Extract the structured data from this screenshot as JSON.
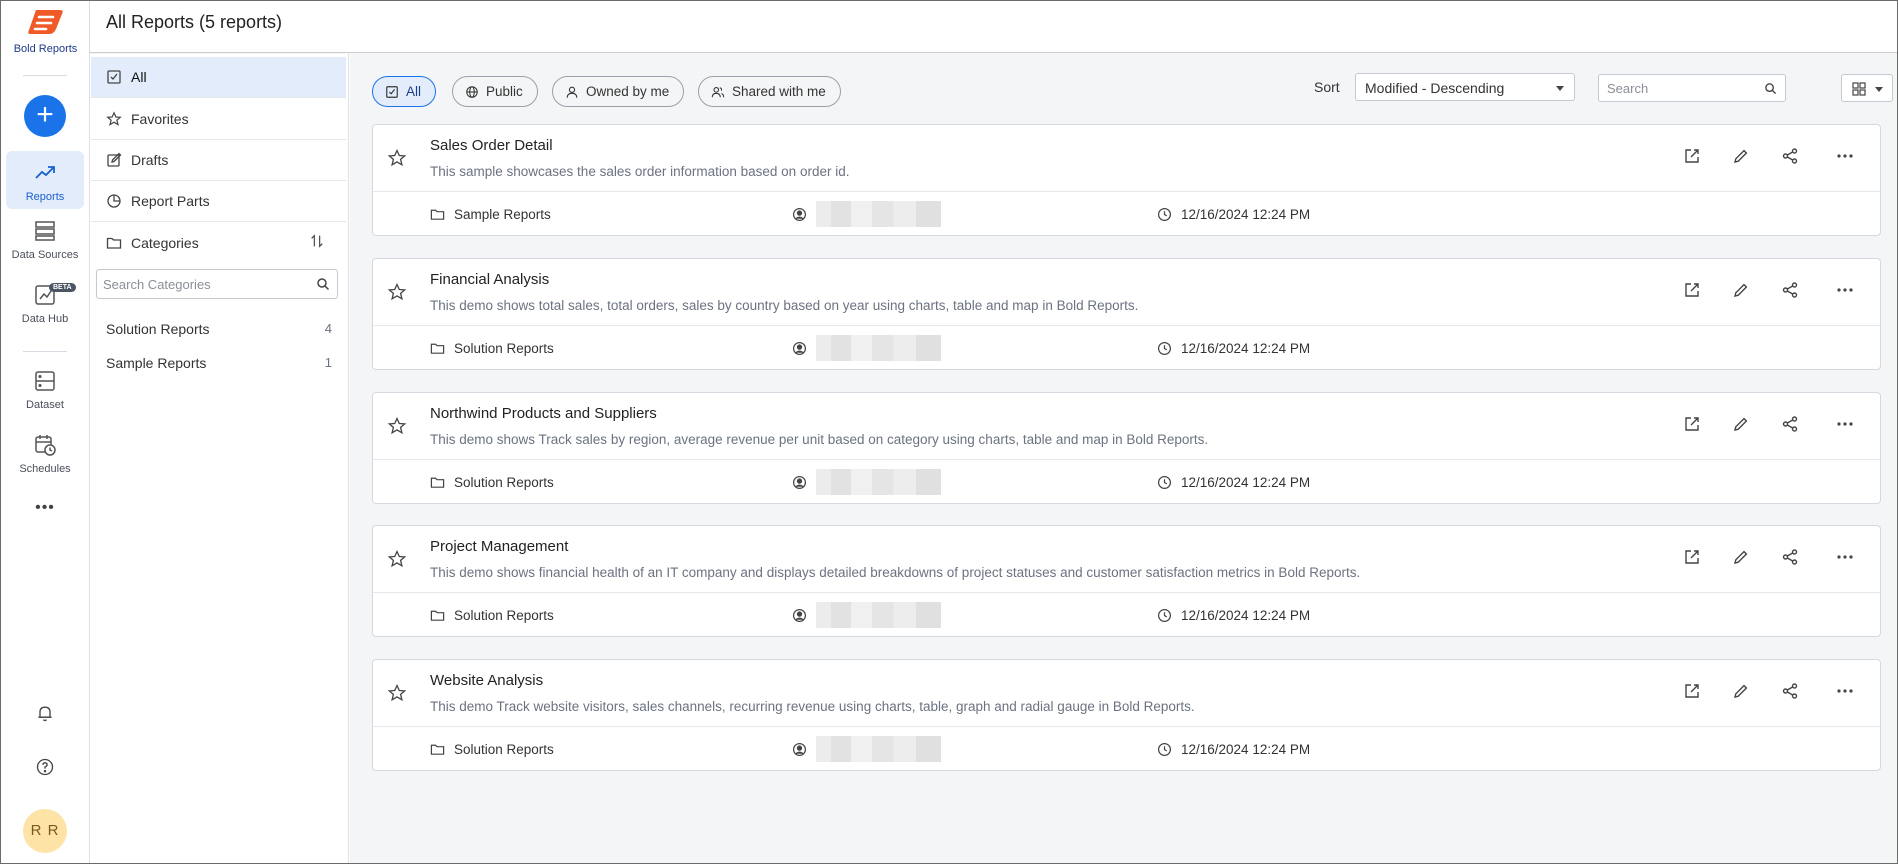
{
  "brand": {
    "logo_text": "Bold Reports",
    "accent": "#1a73e8",
    "logo_color": "#f05a28"
  },
  "rail": {
    "items": [
      {
        "label": "Reports",
        "icon": "trending-up-icon"
      },
      {
        "label": "Data Sources",
        "icon": "database-icon"
      },
      {
        "label": "Data Hub",
        "icon": "chart-box-icon",
        "badge": "BETA"
      },
      {
        "label": "Dataset",
        "icon": "dataset-icon"
      },
      {
        "label": "Schedules",
        "icon": "calendar-clock-icon"
      }
    ],
    "more_label": "•••",
    "avatar_initials": "R R"
  },
  "header": {
    "title": "All Reports (5 reports)"
  },
  "filter": {
    "items": [
      {
        "label": "All",
        "icon": "checkbox-icon"
      },
      {
        "label": "Favorites",
        "icon": "star-icon"
      },
      {
        "label": "Drafts",
        "icon": "edit-icon"
      },
      {
        "label": "Report Parts",
        "icon": "pie-icon"
      },
      {
        "label": "Categories",
        "icon": "folder-icon"
      }
    ],
    "category_search_placeholder": "Search Categories",
    "categories": [
      {
        "name": "Solution Reports",
        "count": "4"
      },
      {
        "name": "Sample Reports",
        "count": "1"
      }
    ]
  },
  "toolbar": {
    "pills": [
      {
        "label": "All",
        "icon": "checkbox-icon"
      },
      {
        "label": "Public",
        "icon": "globe-icon"
      },
      {
        "label": "Owned by me",
        "icon": "user-icon"
      },
      {
        "label": "Shared with me",
        "icon": "users-icon"
      }
    ],
    "sort_label": "Sort",
    "sort_value": "Modified - Descending",
    "search_placeholder": "Search"
  },
  "reports": [
    {
      "title": "Sales Order Detail",
      "description": "This sample showcases the sales order information based on order id.",
      "category": "Sample Reports",
      "modified": "12/16/2024 12:24 PM"
    },
    {
      "title": "Financial Analysis",
      "description": "This demo shows total sales, total orders, sales by country based on year using charts, table and map in Bold Reports.",
      "category": "Solution Reports",
      "modified": "12/16/2024 12:24 PM"
    },
    {
      "title": "Northwind Products and Suppliers",
      "description": "This demo shows Track sales by region, average revenue per unit based on category using charts, table and map in Bold Reports.",
      "category": "Solution Reports",
      "modified": "12/16/2024 12:24 PM"
    },
    {
      "title": "Project Management",
      "description": "This demo shows financial health of an IT company and displays detailed breakdowns of project statuses and customer satisfaction metrics in Bold Reports.",
      "category": "Solution Reports",
      "modified": "12/16/2024 12:24 PM"
    },
    {
      "title": "Website Analysis",
      "description": "This demo Track website visitors, sales channels, recurring revenue using charts, table, graph and radial gauge in Bold Reports.",
      "category": "Solution Reports",
      "modified": "12/16/2024 12:24 PM"
    }
  ]
}
